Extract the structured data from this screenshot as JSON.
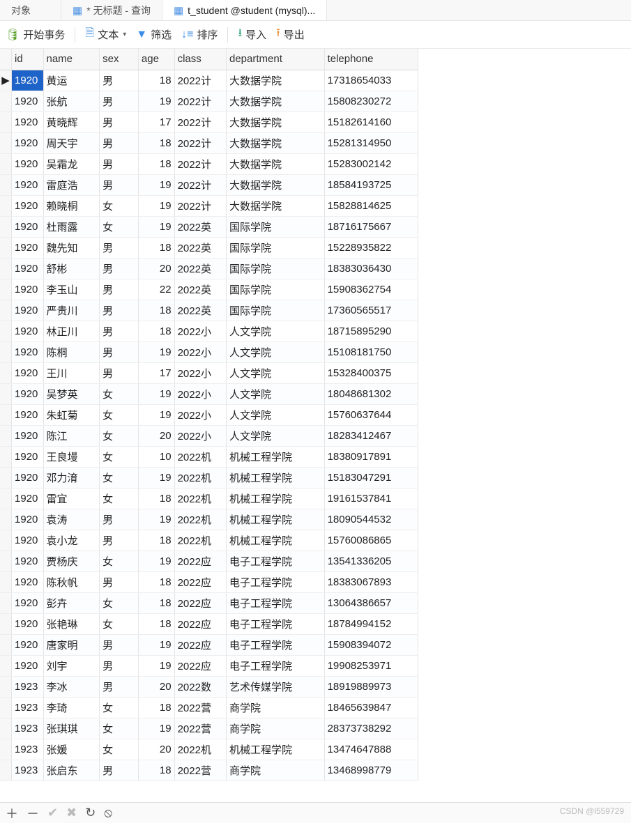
{
  "tabs": [
    {
      "label": "对象",
      "icon": ""
    },
    {
      "label": "* 无标题 - 查询",
      "icon": "query"
    },
    {
      "label": "t_student @student (mysql)...",
      "icon": "table",
      "active": true
    }
  ],
  "toolbar": {
    "begin_tx": "开始事务",
    "text": "文本",
    "filter": "筛选",
    "sort": "排序",
    "import": "导入",
    "export": "导出"
  },
  "columns": [
    "id",
    "name",
    "sex",
    "age",
    "class",
    "department",
    "telephone"
  ],
  "rows": [
    {
      "id": "1920",
      "name": "黄运",
      "sex": "男",
      "age": 18,
      "class": "2022计",
      "dept": "大数据学院",
      "tel": "17318654033",
      "selected": true
    },
    {
      "id": "1920",
      "name": "张航",
      "sex": "男",
      "age": 19,
      "class": "2022计",
      "dept": "大数据学院",
      "tel": "15808230272"
    },
    {
      "id": "1920",
      "name": "黄晓辉",
      "sex": "男",
      "age": 17,
      "class": "2022计",
      "dept": "大数据学院",
      "tel": "15182614160"
    },
    {
      "id": "1920",
      "name": "周天宇",
      "sex": "男",
      "age": 18,
      "class": "2022计",
      "dept": "大数据学院",
      "tel": "15281314950"
    },
    {
      "id": "1920",
      "name": "吴霜龙",
      "sex": "男",
      "age": 18,
      "class": "2022计",
      "dept": "大数据学院",
      "tel": "15283002142"
    },
    {
      "id": "1920",
      "name": "雷庭浩",
      "sex": "男",
      "age": 19,
      "class": "2022计",
      "dept": "大数据学院",
      "tel": "18584193725"
    },
    {
      "id": "1920",
      "name": "赖晓桐",
      "sex": "女",
      "age": 19,
      "class": "2022计",
      "dept": "大数据学院",
      "tel": "15828814625"
    },
    {
      "id": "1920",
      "name": "杜雨露",
      "sex": "女",
      "age": 19,
      "class": "2022英",
      "dept": "国际学院",
      "tel": "18716175667"
    },
    {
      "id": "1920",
      "name": "魏先知",
      "sex": "男",
      "age": 18,
      "class": "2022英",
      "dept": "国际学院",
      "tel": "15228935822"
    },
    {
      "id": "1920",
      "name": "舒彬",
      "sex": "男",
      "age": 20,
      "class": "2022英",
      "dept": "国际学院",
      "tel": "18383036430"
    },
    {
      "id": "1920",
      "name": "李玉山",
      "sex": "男",
      "age": 22,
      "class": "2022英",
      "dept": "国际学院",
      "tel": "15908362754"
    },
    {
      "id": "1920",
      "name": "严贵川",
      "sex": "男",
      "age": 18,
      "class": "2022英",
      "dept": "国际学院",
      "tel": "17360565517"
    },
    {
      "id": "1920",
      "name": "林正川",
      "sex": "男",
      "age": 18,
      "class": "2022小",
      "dept": "人文学院",
      "tel": "18715895290"
    },
    {
      "id": "1920",
      "name": "陈桐",
      "sex": "男",
      "age": 19,
      "class": "2022小",
      "dept": "人文学院",
      "tel": "15108181750"
    },
    {
      "id": "1920",
      "name": "王川",
      "sex": "男",
      "age": 17,
      "class": "2022小",
      "dept": "人文学院",
      "tel": "15328400375"
    },
    {
      "id": "1920",
      "name": "吴梦英",
      "sex": "女",
      "age": 19,
      "class": "2022小",
      "dept": "人文学院",
      "tel": "18048681302"
    },
    {
      "id": "1920",
      "name": "朱虹菊",
      "sex": "女",
      "age": 19,
      "class": "2022小",
      "dept": "人文学院",
      "tel": "15760637644"
    },
    {
      "id": "1920",
      "name": "陈江",
      "sex": "女",
      "age": 20,
      "class": "2022小",
      "dept": "人文学院",
      "tel": "18283412467"
    },
    {
      "id": "1920",
      "name": "王良墁",
      "sex": "女",
      "age": 10,
      "class": "2022机",
      "dept": "机械工程学院",
      "tel": "18380917891"
    },
    {
      "id": "1920",
      "name": "邓力淯",
      "sex": "女",
      "age": 19,
      "class": "2022机",
      "dept": "机械工程学院",
      "tel": "15183047291"
    },
    {
      "id": "1920",
      "name": "雷宜",
      "sex": "女",
      "age": 18,
      "class": "2022机",
      "dept": "机械工程学院",
      "tel": "19161537841"
    },
    {
      "id": "1920",
      "name": "袁涛",
      "sex": "男",
      "age": 19,
      "class": "2022机",
      "dept": "机械工程学院",
      "tel": "18090544532"
    },
    {
      "id": "1920",
      "name": "袁小龙",
      "sex": "男",
      "age": 18,
      "class": "2022机",
      "dept": "机械工程学院",
      "tel": "15760086865"
    },
    {
      "id": "1920",
      "name": "贾杨庆",
      "sex": "女",
      "age": 19,
      "class": "2022应",
      "dept": "电子工程学院",
      "tel": "13541336205"
    },
    {
      "id": "1920",
      "name": "陈秋帆",
      "sex": "男",
      "age": 18,
      "class": "2022应",
      "dept": "电子工程学院",
      "tel": "18383067893"
    },
    {
      "id": "1920",
      "name": "彭卉",
      "sex": "女",
      "age": 18,
      "class": "2022应",
      "dept": "电子工程学院",
      "tel": "13064386657"
    },
    {
      "id": "1920",
      "name": "张艳琳",
      "sex": "女",
      "age": 18,
      "class": "2022应",
      "dept": "电子工程学院",
      "tel": "18784994152"
    },
    {
      "id": "1920",
      "name": "唐家明",
      "sex": "男",
      "age": 19,
      "class": "2022应",
      "dept": "电子工程学院",
      "tel": "15908394072"
    },
    {
      "id": "1920",
      "name": "刘宇",
      "sex": "男",
      "age": 19,
      "class": "2022应",
      "dept": "电子工程学院",
      "tel": "19908253971"
    },
    {
      "id": "1923",
      "name": "李冰",
      "sex": "男",
      "age": 20,
      "class": "2022数",
      "dept": "艺术传媒学院",
      "tel": "18919889973"
    },
    {
      "id": "1923",
      "name": "李琦",
      "sex": "女",
      "age": 18,
      "class": "2022营",
      "dept": "商学院",
      "tel": "18465639847"
    },
    {
      "id": "1923",
      "name": "张琪琪",
      "sex": "女",
      "age": 19,
      "class": "2022营",
      "dept": "商学院",
      "tel": "28373738292"
    },
    {
      "id": "1923",
      "name": "张媛",
      "sex": "女",
      "age": 20,
      "class": "2022机",
      "dept": "机械工程学院",
      "tel": "13474647888"
    },
    {
      "id": "1923",
      "name": "张启东",
      "sex": "男",
      "age": 18,
      "class": "2022营",
      "dept": "商学院",
      "tel": "13468998779"
    }
  ],
  "watermark": "CSDN @l559729"
}
